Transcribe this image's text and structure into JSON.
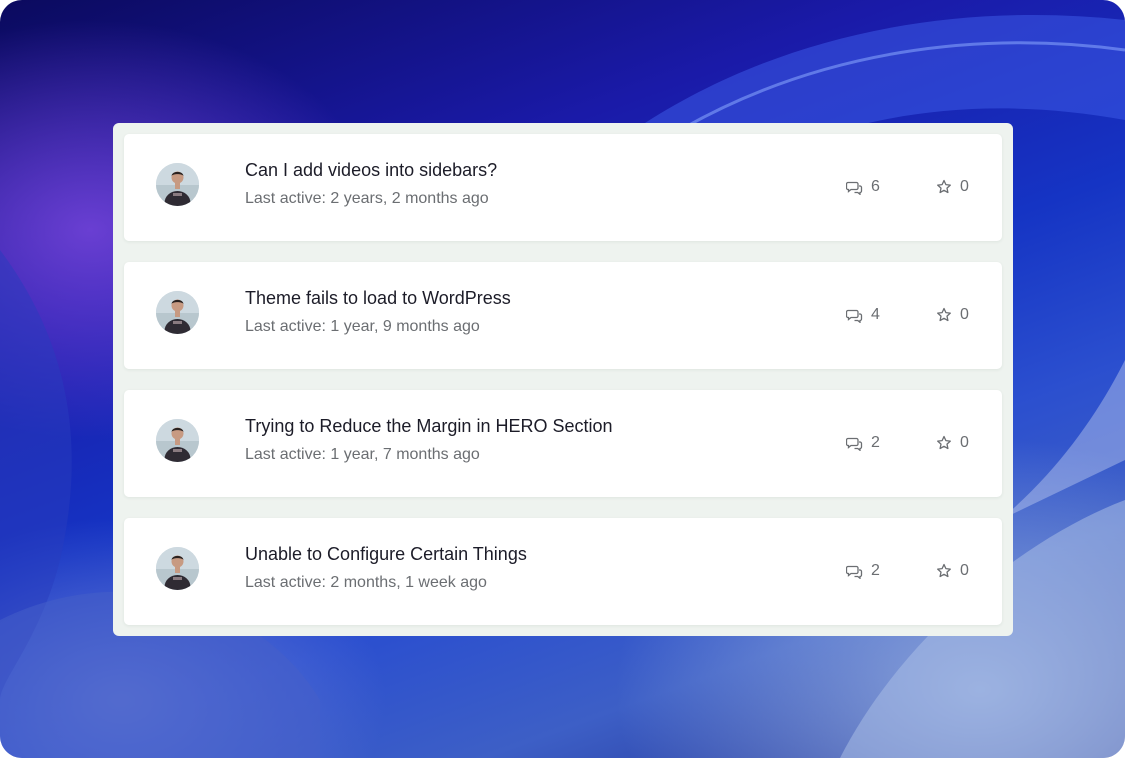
{
  "topics": [
    {
      "title": "Can I add videos into sidebars?",
      "last_active": "Last active: 2 years, 2 months ago",
      "replies": "6",
      "favorites": "0"
    },
    {
      "title": "Theme fails to load to WordPress",
      "last_active": "Last active: 1 year, 9 months ago",
      "replies": "4",
      "favorites": "0"
    },
    {
      "title": "Trying to Reduce the Margin in HERO Section",
      "last_active": "Last active: 1 year, 7 months ago",
      "replies": "2",
      "favorites": "0"
    },
    {
      "title": "Unable to Configure Certain Things",
      "last_active": "Last active: 2 months, 1 week ago",
      "replies": "2",
      "favorites": "0"
    }
  ],
  "icons": {
    "replies": "speech-bubbles-icon",
    "favorites": "star-outline-icon"
  },
  "colors": {
    "panel_background": "#eef3ef",
    "title_text": "#1c1c28",
    "meta_text": "#6b6e72"
  }
}
